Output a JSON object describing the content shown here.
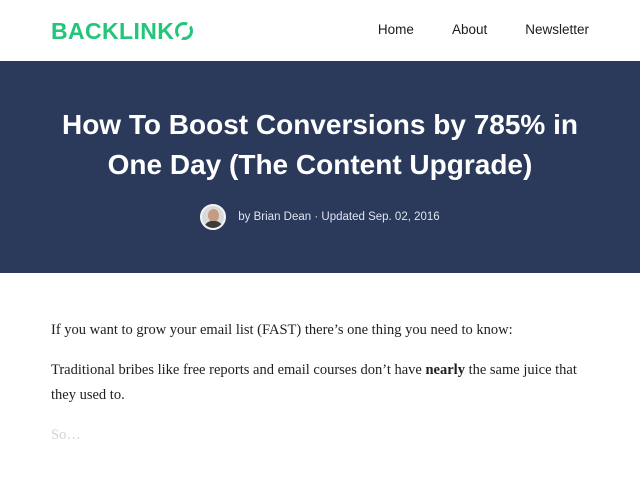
{
  "brand": {
    "logo_text": "BACKLINK",
    "accent_color": "#22c57a"
  },
  "nav": {
    "items": [
      {
        "label": "Home"
      },
      {
        "label": "About"
      },
      {
        "label": "Newsletter"
      }
    ]
  },
  "hero": {
    "background": "#2b3a5b",
    "title": "How To Boost Conversions by 785% in One Day (The Content Upgrade)",
    "author": "by Brian Dean",
    "separator": "·",
    "updated": "Updated Sep. 02, 2016"
  },
  "article": {
    "p1": "If you want to grow your email list (FAST) there’s one thing you need to know:",
    "p2_before": "Traditional bribes like free reports and email courses don’t have ",
    "p2_bold": "nearly",
    "p2_after": " the same juice that they used to.",
    "p3": "So…"
  }
}
